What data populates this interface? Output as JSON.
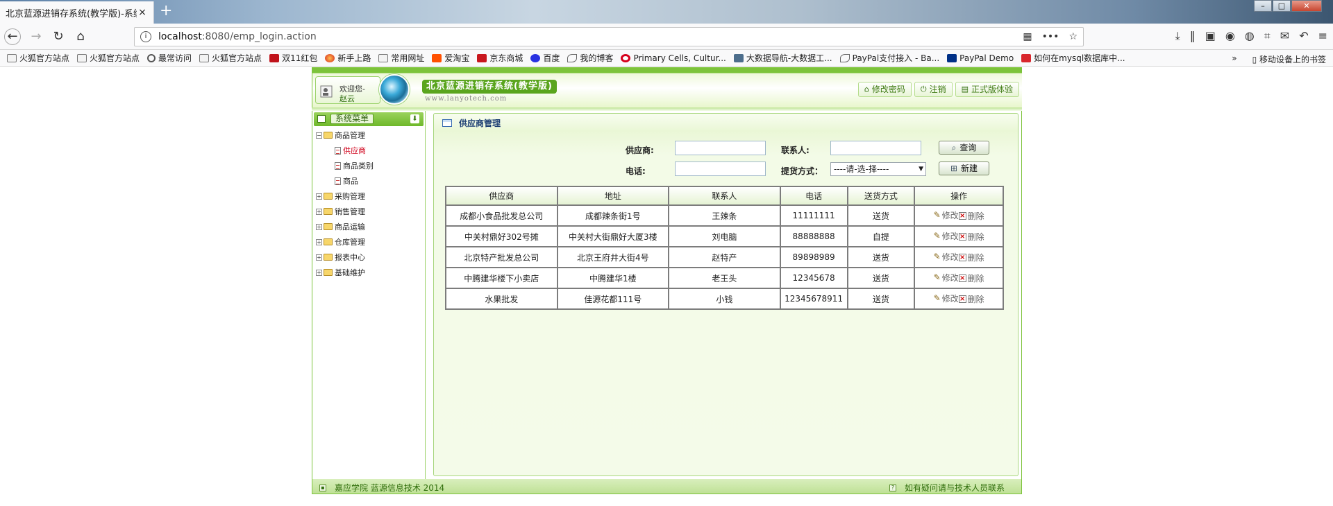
{
  "browser": {
    "tab_title": "北京蓝源进销存系统(教学版)-系统",
    "tab_close": "×",
    "new_tab": "+",
    "url_host": "localhost",
    "url_rest": ":8080/emp_login.action",
    "bookmarks": [
      {
        "label": "火狐官方站点",
        "icon": "folder"
      },
      {
        "label": "火狐官方站点",
        "icon": "folder"
      },
      {
        "label": "最常访问",
        "icon": "gear"
      },
      {
        "label": "火狐官方站点",
        "icon": "folder"
      },
      {
        "label": "双11红包",
        "icon": "red"
      },
      {
        "label": "新手上路",
        "icon": "fox"
      },
      {
        "label": "常用网址",
        "icon": "folder"
      },
      {
        "label": "爱淘宝",
        "icon": "taobao"
      },
      {
        "label": "京东商城",
        "icon": "jd"
      },
      {
        "label": "百度",
        "icon": "baidu"
      },
      {
        "label": "我的博客",
        "icon": "wave"
      },
      {
        "label": "Primary Cells, Cultur...",
        "icon": "opera"
      },
      {
        "label": "大数据导航-大数据工...",
        "icon": "dblue"
      },
      {
        "label": "PayPal支付接入 - Ba...",
        "icon": "wave"
      },
      {
        "label": "PayPal Demo",
        "icon": "pp"
      },
      {
        "label": "如何在mysql数据库中...",
        "icon": "cred"
      }
    ],
    "bookmarks_more": "»",
    "mobile_bookmarks": "移动设备上的书签"
  },
  "header": {
    "welcome_line1": "欢迎您-",
    "welcome_user": "赵云",
    "brand": "北京蓝源进销存系统(教学版)",
    "brand_url": "www.lanyotech.com",
    "buttons": [
      {
        "label": "修改密码",
        "icon": "home-icon",
        "glyph": "⌂"
      },
      {
        "label": "注销",
        "icon": "power-icon",
        "glyph": "⏻"
      },
      {
        "label": "正式版体验",
        "icon": "doc-icon",
        "glyph": "▤"
      }
    ]
  },
  "sidebar": {
    "title": "系统菜单",
    "tree": {
      "root": "商品管理",
      "children": [
        "供应商",
        "商品类别",
        "商品"
      ],
      "active": "供应商",
      "groups": [
        "采购管理",
        "销售管理",
        "商品运输",
        "仓库管理",
        "报表中心",
        "基础维护"
      ]
    }
  },
  "main": {
    "panel_title": "供应商管理",
    "form": {
      "supplier_label": "供应商:",
      "contact_label": "联系人:",
      "phone_label": "电话:",
      "delivery_label": "提货方式：",
      "delivery_value": "----请-选-择----",
      "search_button": "查询",
      "new_button": "新建",
      "supplier_value": "",
      "contact_value": "",
      "phone_value": ""
    },
    "table": {
      "headers": [
        "供应商",
        "地址",
        "联系人",
        "电话",
        "送货方式",
        "操作"
      ],
      "edit_label": "修改",
      "delete_label": "删除",
      "rows": [
        [
          "成都小食品批发总公司",
          "成都辣条街1号",
          "王辣条",
          "11111111",
          "送货"
        ],
        [
          "中关村鼎好302号摊",
          "中关村大街鼎好大厦3楼",
          "刘电脑",
          "88888888",
          "自提"
        ],
        [
          "北京特产批发总公司",
          "北京王府井大街4号",
          "赵特产",
          "89898989",
          "送货"
        ],
        [
          "中腾建华楼下小卖店",
          "中腾建华1楼",
          "老王头",
          "12345678",
          "送货"
        ],
        [
          "水果批发",
          "佳源花都111号",
          "小钱",
          "12345678911",
          "送货"
        ]
      ]
    }
  },
  "footer": {
    "left": "嘉应学院 蓝源信息技术 2014",
    "right": "如有疑问请与技术人员联系"
  }
}
